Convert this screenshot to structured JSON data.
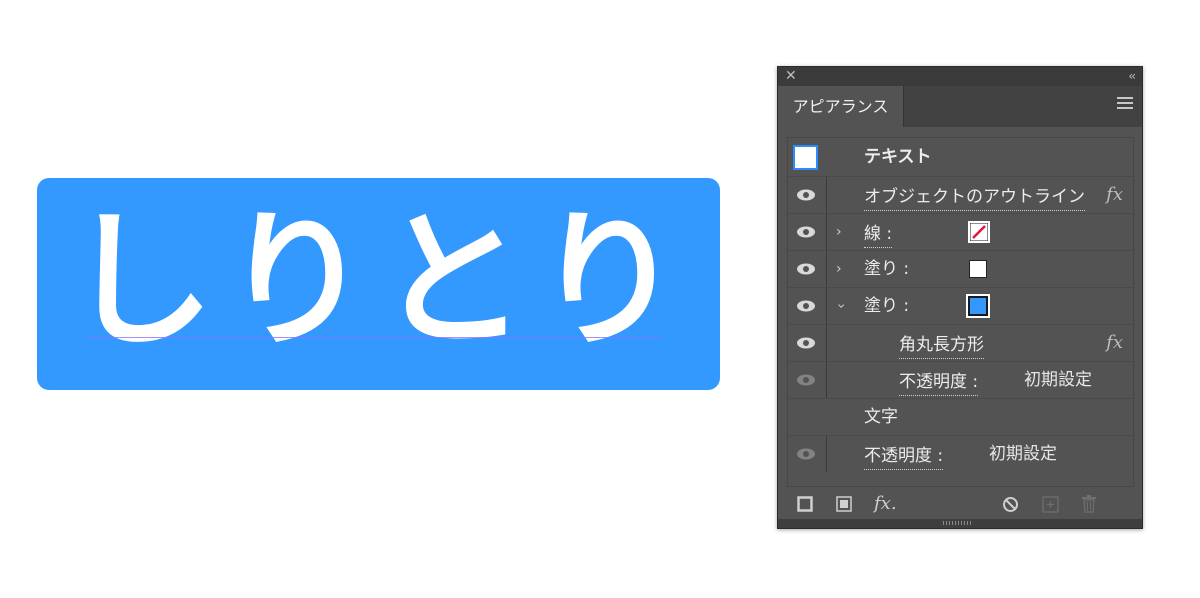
{
  "artwork": {
    "text": "しりとり",
    "fill_color": "#3399ff"
  },
  "panel": {
    "tab_label": "アピアランス",
    "header": {
      "label": "テキスト"
    },
    "rows": [
      {
        "label": "オブジェクトのアウトライン",
        "fx": "fx"
      },
      {
        "label": "線 :",
        "swatch": "none"
      },
      {
        "label": "塗り :",
        "swatch": "#ffffff"
      },
      {
        "label": "塗り :",
        "swatch": "#3399ff"
      },
      {
        "label": "角丸長方形",
        "fx": "fx"
      },
      {
        "label": "不透明度 :",
        "value": "初期設定"
      },
      {
        "label": "文字"
      },
      {
        "label": "不透明度 :",
        "value": "初期設定"
      }
    ],
    "footer": {
      "fx_label": "fx."
    }
  }
}
